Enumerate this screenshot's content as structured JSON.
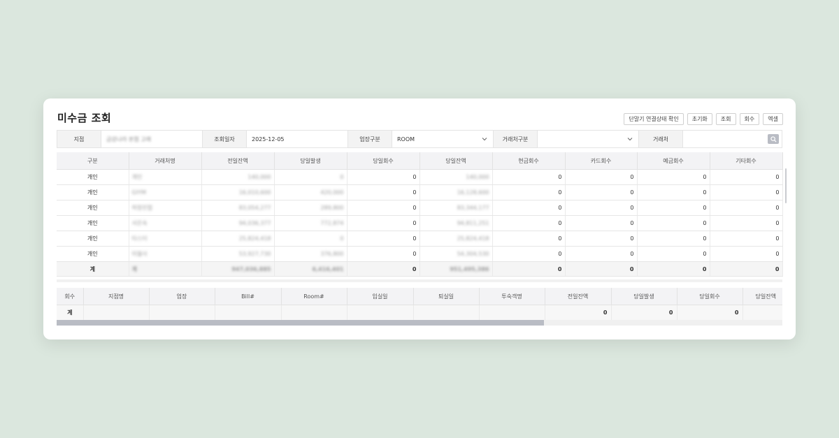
{
  "title": "미수금 조회",
  "toolbar": {
    "device_check": "단말기 연결상태 확인",
    "reset": "초기화",
    "search": "조회",
    "collect": "회수",
    "excel": "엑셀"
  },
  "filter": {
    "branch_label": "지점",
    "branch_value": "금강나라 본점 고래",
    "date_label": "조회일자",
    "date_value": "2025-12-05",
    "biz_label": "업장구분",
    "biz_value": "ROOM",
    "partner_type_label": "거래처구분",
    "partner_type_value": "",
    "partner_label": "거래처",
    "partner_value": ""
  },
  "main_grid": {
    "headers": [
      "구분",
      "거래처명",
      "전일잔액",
      "당일발생",
      "당일회수",
      "당일잔액",
      "현금회수",
      "카드회수",
      "예금회수",
      "기타회수"
    ],
    "rows": [
      [
        "개인",
        "개인",
        "140,000",
        "0",
        "0",
        "140,000",
        "0",
        "0",
        "0",
        "0"
      ],
      [
        "개인",
        "GIYM",
        "16,010,600",
        "420,000",
        "0",
        "16,128,600",
        "0",
        "0",
        "0",
        "0"
      ],
      [
        "개인",
        "허정진협",
        "83,054,277",
        "289,800",
        "0",
        "83,344,177",
        "0",
        "0",
        "0",
        "0"
      ],
      [
        "개인",
        "서은숙",
        "94,036,377",
        "772,874",
        "0",
        "94,811,251",
        "0",
        "0",
        "0",
        "0"
      ],
      [
        "개인",
        "타스터",
        "25,824,418",
        "0",
        "0",
        "25,824,418",
        "0",
        "0",
        "0",
        "0"
      ],
      [
        "개인",
        "미월사",
        "53,927,730",
        "376,800",
        "0",
        "54,304,530",
        "0",
        "0",
        "0",
        "0"
      ]
    ],
    "total": [
      "계",
      "계",
      "947,036,885",
      "6,416,401",
      "0",
      "951,495,386",
      "0",
      "0",
      "0",
      "0"
    ]
  },
  "sub_grid": {
    "headers": [
      "회수",
      "지점명",
      "업장",
      "Bill#",
      "Room#",
      "입실일",
      "퇴실일",
      "투숙객명",
      "전일잔액",
      "당일발생",
      "당일회수",
      "당일잔액"
    ],
    "total": [
      "계",
      "",
      "",
      "",
      "",
      "",
      "",
      "",
      "0",
      "0",
      "0",
      ""
    ]
  }
}
